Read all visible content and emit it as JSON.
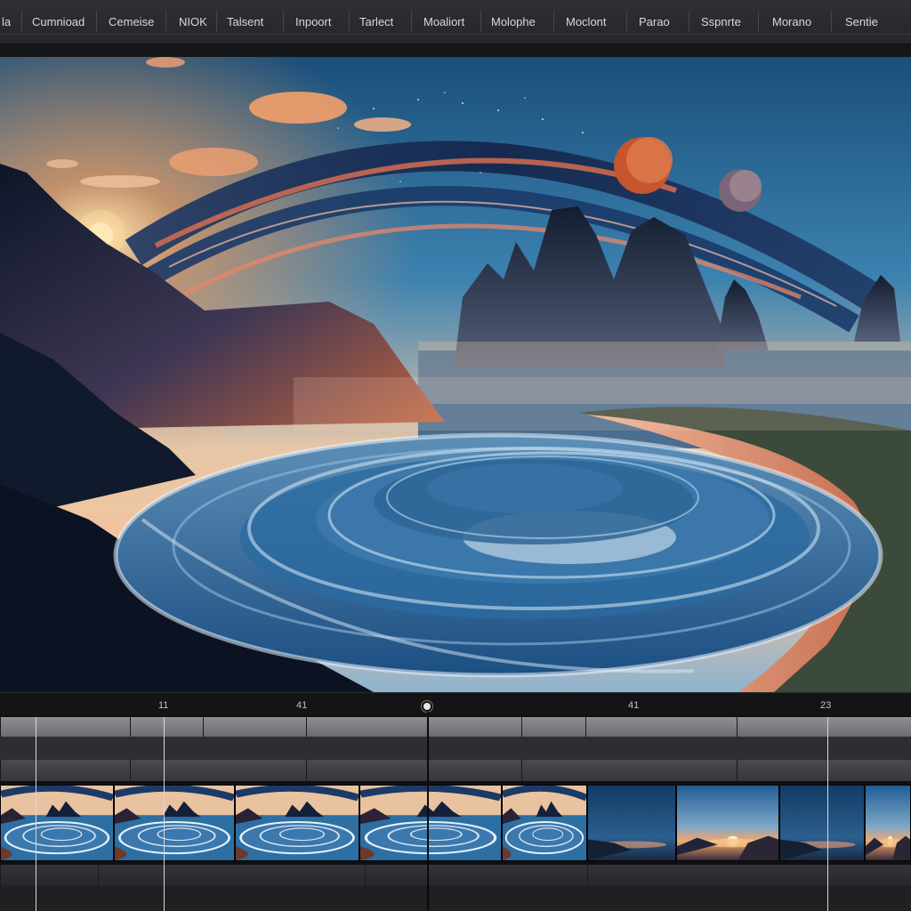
{
  "menu": {
    "items": [
      {
        "label": "la",
        "name": "menu-la"
      },
      {
        "label": "Cumnioad",
        "name": "menu-cumnioad"
      },
      {
        "label": "Cemeise",
        "name": "menu-cemeise"
      },
      {
        "label": "NIOK",
        "name": "menu-niok"
      },
      {
        "label": "Talsent",
        "name": "menu-talsent"
      },
      {
        "label": "Inpoort",
        "name": "menu-inpoort"
      },
      {
        "label": "Tarlect",
        "name": "menu-tarlect"
      },
      {
        "label": "Moaliort",
        "name": "menu-moaliort"
      },
      {
        "label": "Molophe",
        "name": "menu-molophe"
      },
      {
        "label": "Moclont",
        "name": "menu-moclont"
      },
      {
        "label": "Parao",
        "name": "menu-parao"
      },
      {
        "label": "Sspnrte",
        "name": "menu-sspnrte"
      },
      {
        "label": "Morano",
        "name": "menu-morano"
      },
      {
        "label": "Sentie",
        "name": "menu-sentie"
      }
    ]
  },
  "ruler": {
    "labels": [
      "11",
      "41",
      "41",
      "23"
    ]
  },
  "viewer": {
    "scene": "coastal-sunset-spiral-waves"
  },
  "timeline": {
    "clips": [
      {
        "name": "clip-1",
        "variant": "spiral"
      },
      {
        "name": "clip-2",
        "variant": "spiral"
      },
      {
        "name": "clip-3",
        "variant": "spiral"
      },
      {
        "name": "clip-4",
        "variant": "spiral"
      },
      {
        "name": "clip-5",
        "variant": "spiral"
      },
      {
        "name": "clip-6",
        "variant": "dusk"
      },
      {
        "name": "clip-7",
        "variant": "sunset"
      },
      {
        "name": "clip-8",
        "variant": "dusk"
      },
      {
        "name": "clip-9",
        "variant": "sunset"
      },
      {
        "name": "clip-10",
        "variant": "dusk"
      }
    ]
  },
  "colors": {
    "sky_top": "#1d5a86",
    "sky_glow": "#f2b07a",
    "sun": "#fff2c4",
    "ocean": "#2b6aa0",
    "sand": "#d98a6a",
    "mountain": "#0f1a2b"
  }
}
